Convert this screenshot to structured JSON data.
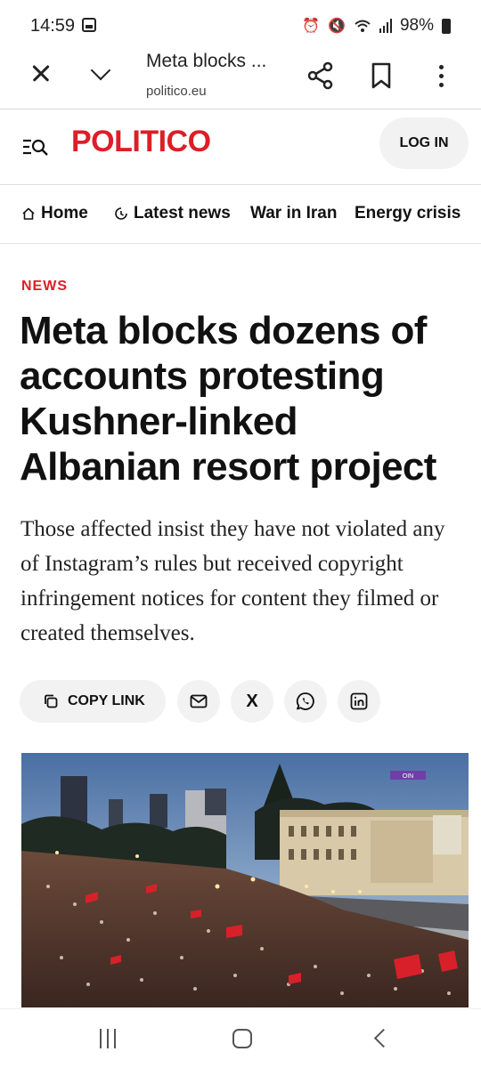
{
  "status_bar": {
    "time": "14:59",
    "battery": "98%",
    "icons": [
      "image-icon",
      "alarm-icon",
      "mute-icon",
      "wifi-icon",
      "signal-icon",
      "battery-icon"
    ]
  },
  "browser": {
    "page_title": "Meta blocks ...",
    "url": "politico.eu",
    "icons": [
      "close-icon",
      "chevron-down-icon",
      "share-icon",
      "bookmark-icon",
      "more-vert-icon"
    ]
  },
  "site": {
    "logo": "POLITICO",
    "login_label": "LOG IN",
    "brand_color": "#dc1e28"
  },
  "nav": {
    "items": [
      {
        "label": "Home",
        "icon": "home-icon"
      },
      {
        "label": "Latest news",
        "icon": "clock-icon"
      },
      {
        "label": "War in Iran"
      },
      {
        "label": "Energy crisis"
      }
    ]
  },
  "article": {
    "kicker": "NEWS",
    "headline": "Meta blocks dozens of accounts protesting Kushner-linked Albanian resort project",
    "dek": "Those affected insist they have not violated any of Instagram’s rules but received copyright infringement notices for content they filmed or created themselves."
  },
  "share": {
    "copy_link_label": "COPY LINK",
    "x_label": "X",
    "icons": [
      "copy-icon",
      "email-icon",
      "x-icon",
      "whatsapp-icon",
      "linkedin-icon"
    ]
  },
  "photo": {
    "sign_text": "OIN"
  }
}
